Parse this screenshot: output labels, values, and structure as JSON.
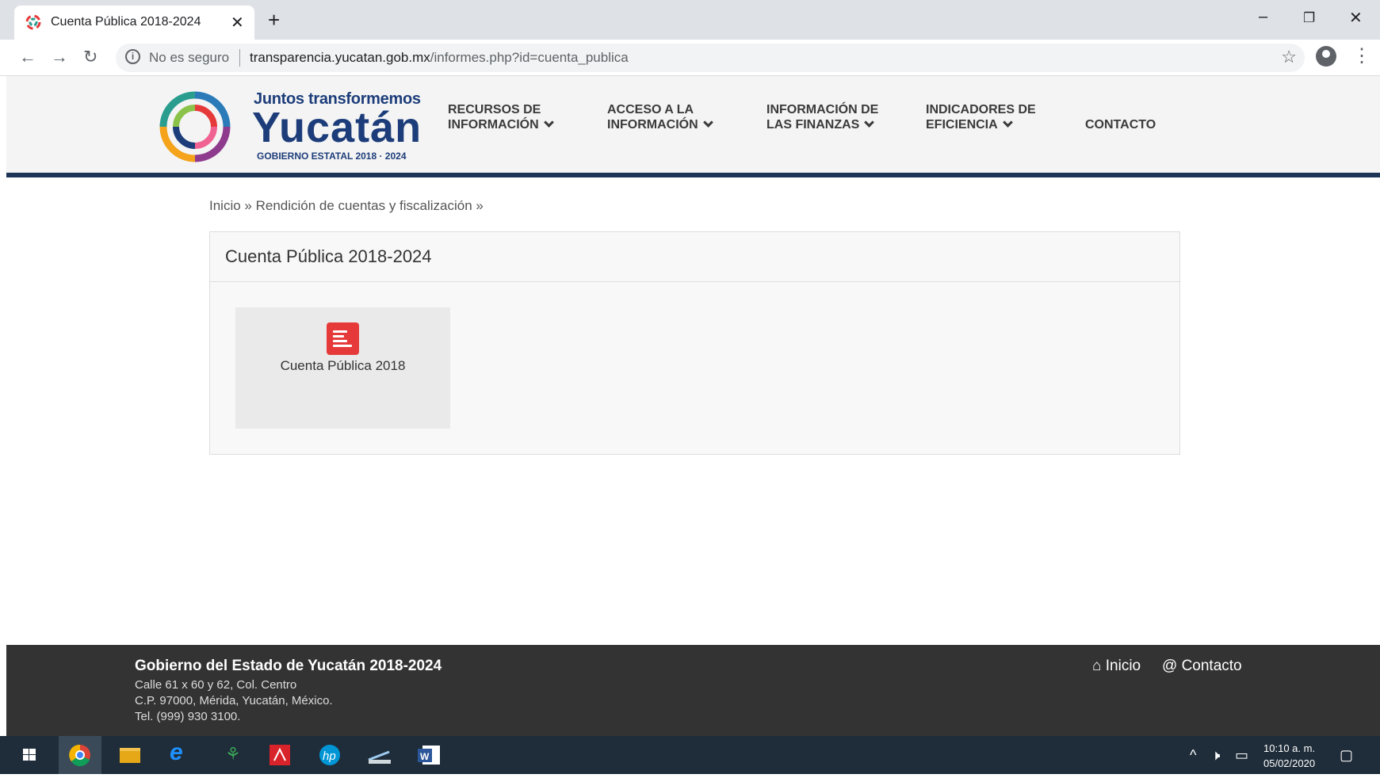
{
  "browser": {
    "tab_title": "Cuenta Pública 2018-2024",
    "close_glyph": "✕",
    "new_tab_glyph": "+",
    "minimize_glyph": "–",
    "restore_glyph": "❐",
    "window_close_glyph": "✕",
    "back_glyph": "←",
    "forward_glyph": "→",
    "reload_glyph": "↻",
    "insecure_label": "No es seguro",
    "url_host": "transparencia.yucatan.gob.mx",
    "url_path": "/informes.php?id=cuenta_publica",
    "star_glyph": "☆",
    "menu_glyph": "⋮"
  },
  "header": {
    "logo_tagline": "Juntos transformemos",
    "logo_name": "Yucatán",
    "logo_subtitle": "GOBIERNO ESTATAL 2018 · 2024",
    "nav": [
      {
        "line1": "RECURSOS DE",
        "line2": "INFORMACIÓN"
      },
      {
        "line1": "ACCESO A LA",
        "line2": "INFORMACIÓN"
      },
      {
        "line1": "INFORMACIÓN DE",
        "line2": "LAS FINANZAS"
      },
      {
        "line1": "INDICADORES DE",
        "line2": "EFICIENCIA"
      }
    ],
    "contact": "CONTACTO"
  },
  "breadcrumb": {
    "home": "Inicio",
    "sep1": " » ",
    "section": "Rendición de cuentas y fiscalización",
    "sep2": " »"
  },
  "panel": {
    "title": "Cuenta Pública 2018-2024",
    "tile_label": "Cuenta Pública 2018",
    "tile_icon": "document-icon",
    "tile_icon_color": "#e63a3a"
  },
  "footer": {
    "title": "Gobierno del Estado de Yucatán 2018-2024",
    "address1": "Calle 61 x 60 y 62, Col. Centro",
    "address2": "C.P. 97000, Mérida, Yucatán, México.",
    "phone": "Tel. (999) 930 3100.",
    "home_link": "Inicio",
    "contact_link": "Contacto"
  },
  "taskbar": {
    "time": "10:10 a. m.",
    "date": "05/02/2020"
  },
  "colors": {
    "header_rule": "#1d3557",
    "footer_bg": "#333333",
    "taskbar_bg": "#1f2d3a"
  }
}
